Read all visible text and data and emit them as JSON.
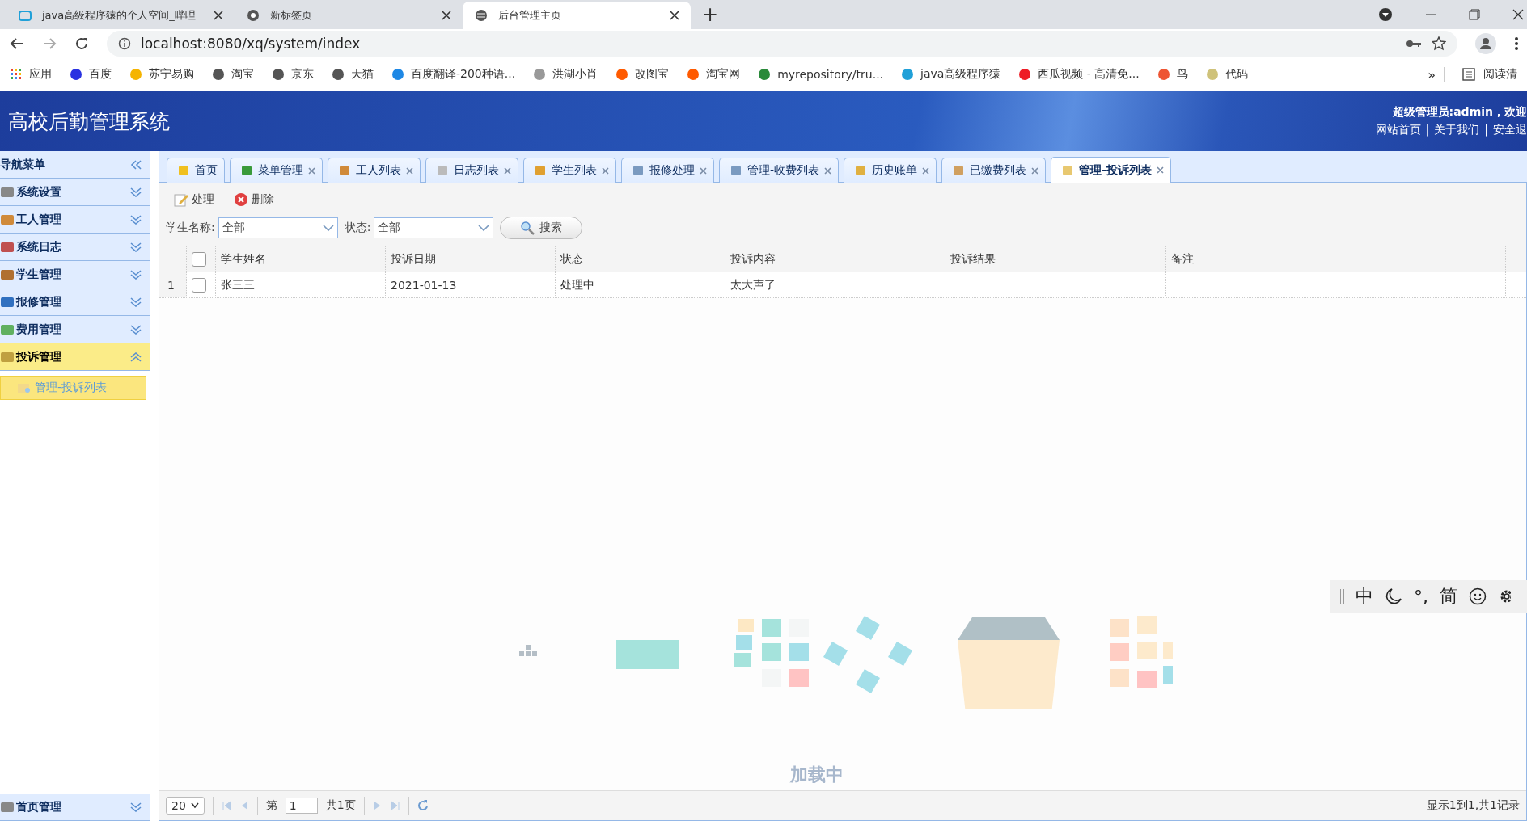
{
  "browser": {
    "tabs": [
      {
        "title": "java高级程序猿的个人空间_哔哩",
        "selected": false
      },
      {
        "title": "新标签页",
        "selected": false
      },
      {
        "title": "后台管理主页",
        "selected": true
      }
    ],
    "new_tab": "+",
    "address": "localhost:8080/xq/system/index",
    "bookmarks": [
      "应用",
      "百度",
      "苏宁易购",
      "淘宝",
      "京东",
      "天猫",
      "百度翻译-200种语...",
      "洪湖小肖",
      "改图宝",
      "淘宝网",
      "myrepository/tru...",
      "java高级程序猿",
      "西瓜视频 - 高清免...",
      "鸟",
      "代码"
    ],
    "more": "»",
    "reading_list": "阅读清"
  },
  "header": {
    "title": "高校后勤管理系统",
    "user": "超级管理员:admin，欢迎",
    "links": [
      "网站首页",
      "关于我们",
      "安全退"
    ],
    "separator": "|"
  },
  "sidebar": {
    "title": "导航菜单",
    "groups": [
      {
        "label": "系统设置",
        "expanded": false
      },
      {
        "label": "工人管理",
        "expanded": false
      },
      {
        "label": "系统日志",
        "expanded": false
      },
      {
        "label": "学生管理",
        "expanded": false
      },
      {
        "label": "报修管理",
        "expanded": false
      },
      {
        "label": "费用管理",
        "expanded": false
      },
      {
        "label": "投诉管理",
        "expanded": true,
        "children": [
          {
            "label": "管理-投诉列表",
            "selected": true
          }
        ]
      }
    ],
    "bottom_group": {
      "label": "首页管理",
      "expanded": false
    }
  },
  "tabs": [
    {
      "label": "首页",
      "closable": false,
      "selected": false
    },
    {
      "label": "菜单管理",
      "closable": true,
      "selected": false
    },
    {
      "label": "工人列表",
      "closable": true,
      "selected": false
    },
    {
      "label": "日志列表",
      "closable": true,
      "selected": false
    },
    {
      "label": "学生列表",
      "closable": true,
      "selected": false
    },
    {
      "label": "报修处理",
      "closable": true,
      "selected": false
    },
    {
      "label": "管理-收费列表",
      "closable": true,
      "selected": false
    },
    {
      "label": "历史账单",
      "closable": true,
      "selected": false
    },
    {
      "label": "已缴费列表",
      "closable": true,
      "selected": false
    },
    {
      "label": "管理-投诉列表",
      "closable": true,
      "selected": true
    }
  ],
  "toolbar": [
    "处理",
    "删除"
  ],
  "filters": [
    {
      "label": "学生名称:",
      "value": "全部"
    },
    {
      "label": "状态:",
      "value": "全部"
    }
  ],
  "search_button": "搜索",
  "table": {
    "select_all_checked": false,
    "columns": [
      "学生姓名",
      "投诉日期",
      "状态",
      "投诉内容",
      "投诉结果",
      "备注"
    ],
    "rows": [
      {
        "number": "1",
        "checked": false,
        "cells": [
          "张三三",
          "2021-01-13",
          "处理中",
          "太大声了",
          "",
          ""
        ]
      }
    ]
  },
  "pager": {
    "page_size": "20",
    "page_label": "第",
    "page": "1",
    "total": "共1页",
    "summary": "显示1到1,共1记录"
  },
  "loading": "加载中",
  "ime": [
    "中",
    "°,",
    "简"
  ]
}
